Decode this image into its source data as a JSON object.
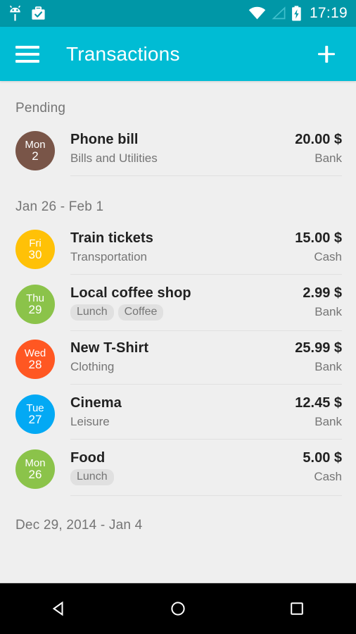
{
  "statusbar": {
    "time": "17:19",
    "icons": [
      "android-bug-icon",
      "briefcase-check-icon",
      "wifi-icon",
      "signal-icon",
      "battery-charging-icon"
    ]
  },
  "toolbar": {
    "menu_icon": "hamburger-menu-icon",
    "title": "Transactions",
    "add_icon": "plus-icon",
    "background": "#00bcd4"
  },
  "sections": [
    {
      "header": "Pending",
      "rows": [
        {
          "day": "Mon",
          "date": "2",
          "color": "#795548",
          "title": "Phone bill",
          "subtitle": "Bills and Utilities",
          "tags": [],
          "amount": "20.00 $",
          "account": "Bank"
        }
      ]
    },
    {
      "header": "Jan 26 - Feb 1",
      "rows": [
        {
          "day": "Fri",
          "date": "30",
          "color": "#ffc107",
          "title": "Train tickets",
          "subtitle": "Transportation",
          "tags": [],
          "amount": "15.00 $",
          "account": "Cash"
        },
        {
          "day": "Thu",
          "date": "29",
          "color": "#8bc34a",
          "title": "Local coffee shop",
          "subtitle": "",
          "tags": [
            "Lunch",
            "Coffee"
          ],
          "amount": "2.99 $",
          "account": "Bank"
        },
        {
          "day": "Wed",
          "date": "28",
          "color": "#ff5722",
          "title": "New T-Shirt",
          "subtitle": "Clothing",
          "tags": [],
          "amount": "25.99 $",
          "account": "Bank"
        },
        {
          "day": "Tue",
          "date": "27",
          "color": "#03a9f4",
          "title": "Cinema",
          "subtitle": "Leisure",
          "tags": [],
          "amount": "12.45 $",
          "account": "Bank"
        },
        {
          "day": "Mon",
          "date": "26",
          "color": "#8bc34a",
          "title": "Food",
          "subtitle": "",
          "tags": [
            "Lunch"
          ],
          "amount": "5.00 $",
          "account": "Cash"
        }
      ]
    },
    {
      "header": "Dec 29, 2014 - Jan 4",
      "rows": []
    }
  ],
  "navbar": {
    "back_label": "back-triangle-icon",
    "home_label": "home-circle-icon",
    "recents_label": "recents-square-icon"
  }
}
